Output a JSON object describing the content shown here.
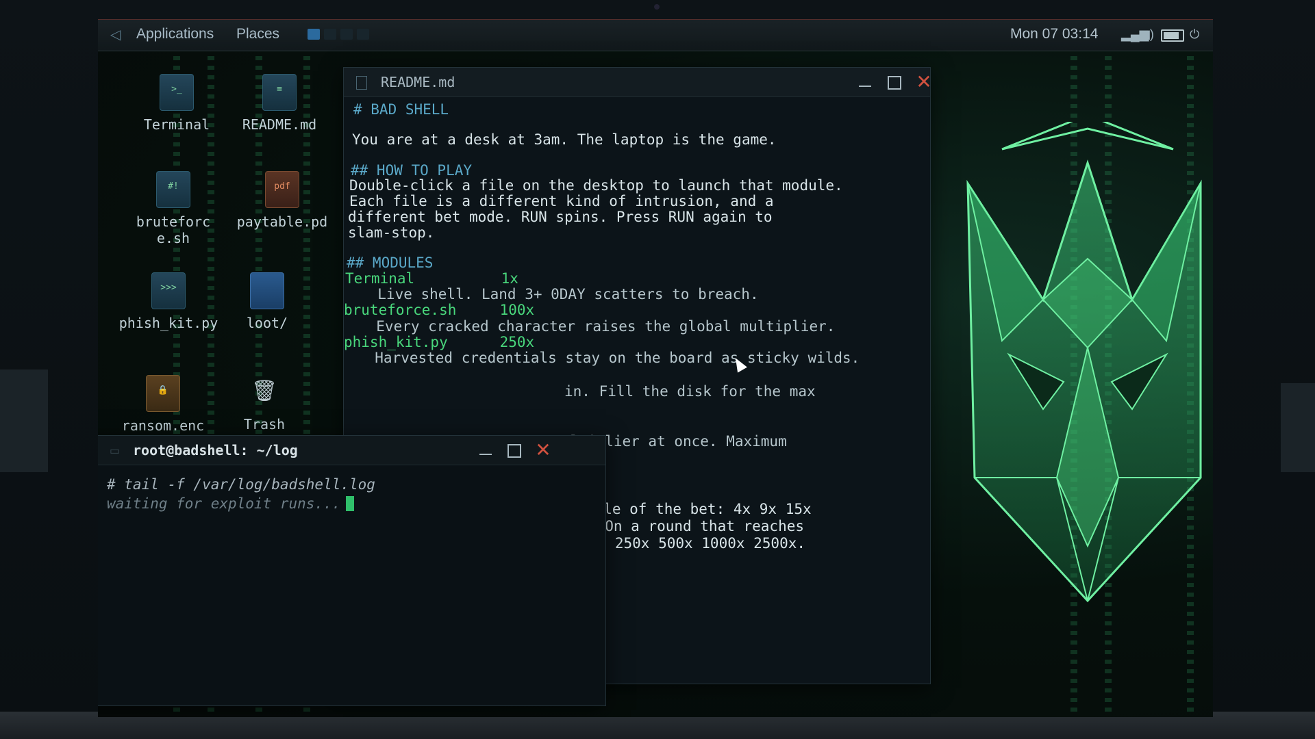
{
  "panel": {
    "menus": [
      "Applications",
      "Places"
    ],
    "clock": "Mon 07 03:14"
  },
  "desktop": {
    "icons": [
      {
        "label": "Terminal",
        "icon": "terminal-icon",
        "glyph": ">_"
      },
      {
        "label": "README.md",
        "icon": "document-icon",
        "glyph": "≡"
      },
      {
        "label": "bruteforce.sh",
        "icon": "shell-script-icon",
        "glyph": "#!"
      },
      {
        "label": "paytable.pd",
        "icon": "pdf-icon",
        "glyph": "pdf"
      },
      {
        "label": "phish_kit.py",
        "icon": "python-file-icon",
        "glyph": ">>>"
      },
      {
        "label": "loot/",
        "icon": "folder-icon",
        "glyph": ""
      },
      {
        "label": "ransom.enc",
        "icon": "encrypted-file-icon",
        "glyph": "🔒"
      },
      {
        "label": "Trash",
        "icon": "trash-icon",
        "glyph": "🗑"
      }
    ]
  },
  "readme": {
    "title": "README.md",
    "lines": [
      {
        "text": "# BAD SHELL",
        "style": "head"
      },
      {
        "text": "You are at a desk at 3am. The laptop is the game.",
        "style": "text"
      },
      {
        "text": "## HOW TO PLAY",
        "style": "head"
      },
      {
        "text": "Double-click a file on the desktop to launch that module.",
        "style": "text"
      },
      {
        "text": "Each file is a different kind of intrusion, and a",
        "style": "text"
      },
      {
        "text": "different bet mode. RUN spins. Press RUN again to",
        "style": "text"
      },
      {
        "text": "slam-stop.",
        "style": "text"
      },
      {
        "text": "## MODULES",
        "style": "head"
      },
      {
        "text": "Terminal          1x",
        "style": "mod"
      },
      {
        "text": "  Live shell. Land 3+ 0DAY scatters to breach.",
        "style": "desc"
      },
      {
        "text": "bruteforce.sh     100x",
        "style": "mod"
      },
      {
        "text": "  Every cracked character raises the global multiplier.",
        "style": "desc"
      },
      {
        "text": "phish_kit.py      250x",
        "style": "mod"
      },
      {
        "text": "  Harvested credentials stay on the board as sticky wilds.",
        "style": "desc"
      },
      {
        "text": "in. Fill the disk for the max",
        "style": "desc"
      },
      {
        "text": "ultiplier at once. Maximum",
        "style": "desc"
      },
      {
        "text": "ultiple of the bet: 4x 9x 15x",
        "style": "text"
      },
      {
        "text": "00x. On a round that reaches",
        "style": "text"
      },
      {
        "text": " 100x 250x 500x 1000x 2500x.",
        "style": "text"
      }
    ]
  },
  "terminal": {
    "title": "root@badshell: ~/log",
    "command": "# tail -f /var/log/badshell.log",
    "status": "waiting for exploit runs..."
  },
  "colors": {
    "accent_green": "#49d77c",
    "heading_blue": "#5aa8c8",
    "close_red": "#d0513f"
  }
}
